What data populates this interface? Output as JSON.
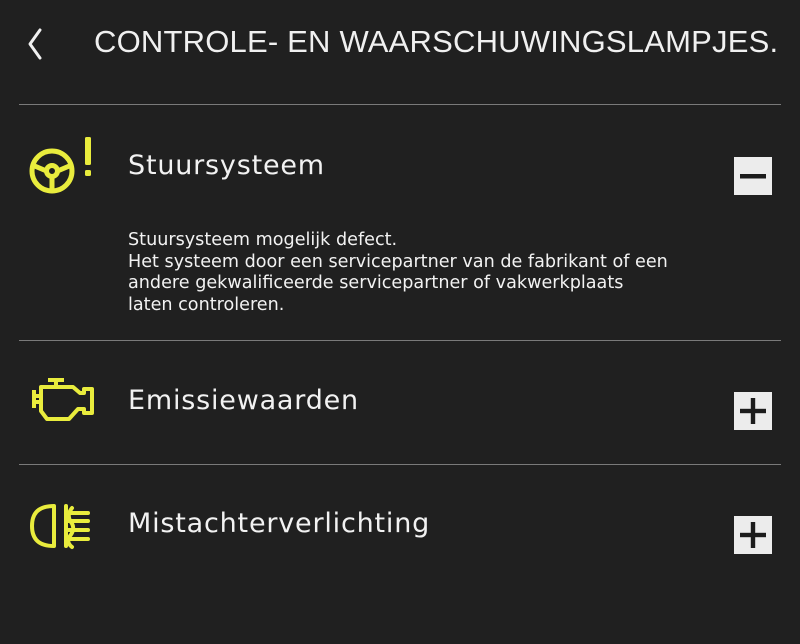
{
  "header": {
    "title": "CONTROLE- EN WAARSCHUWINGSLAMPJES."
  },
  "sections": [
    {
      "title": "Stuursysteem",
      "icon": "steering-warning-icon",
      "expanded": true,
      "body_lines": [
        "Stuursysteem mogelijk defect.",
        "Het systeem door een servicepartner van de fabrikant of een",
        "andere gekwalificeerde servicepartner of vakwerkplaats",
        "laten controleren."
      ]
    },
    {
      "title": "Emissiewaarden",
      "icon": "engine-icon",
      "expanded": false
    },
    {
      "title": "Mistachterverlichting",
      "icon": "rear-fog-light-icon",
      "expanded": false
    }
  ],
  "colors": {
    "background": "#202020",
    "text": "#f2f2f2",
    "warning_icon": "#e9ec3d",
    "divider": "#7a7a7a",
    "button_bg": "#ececec"
  }
}
